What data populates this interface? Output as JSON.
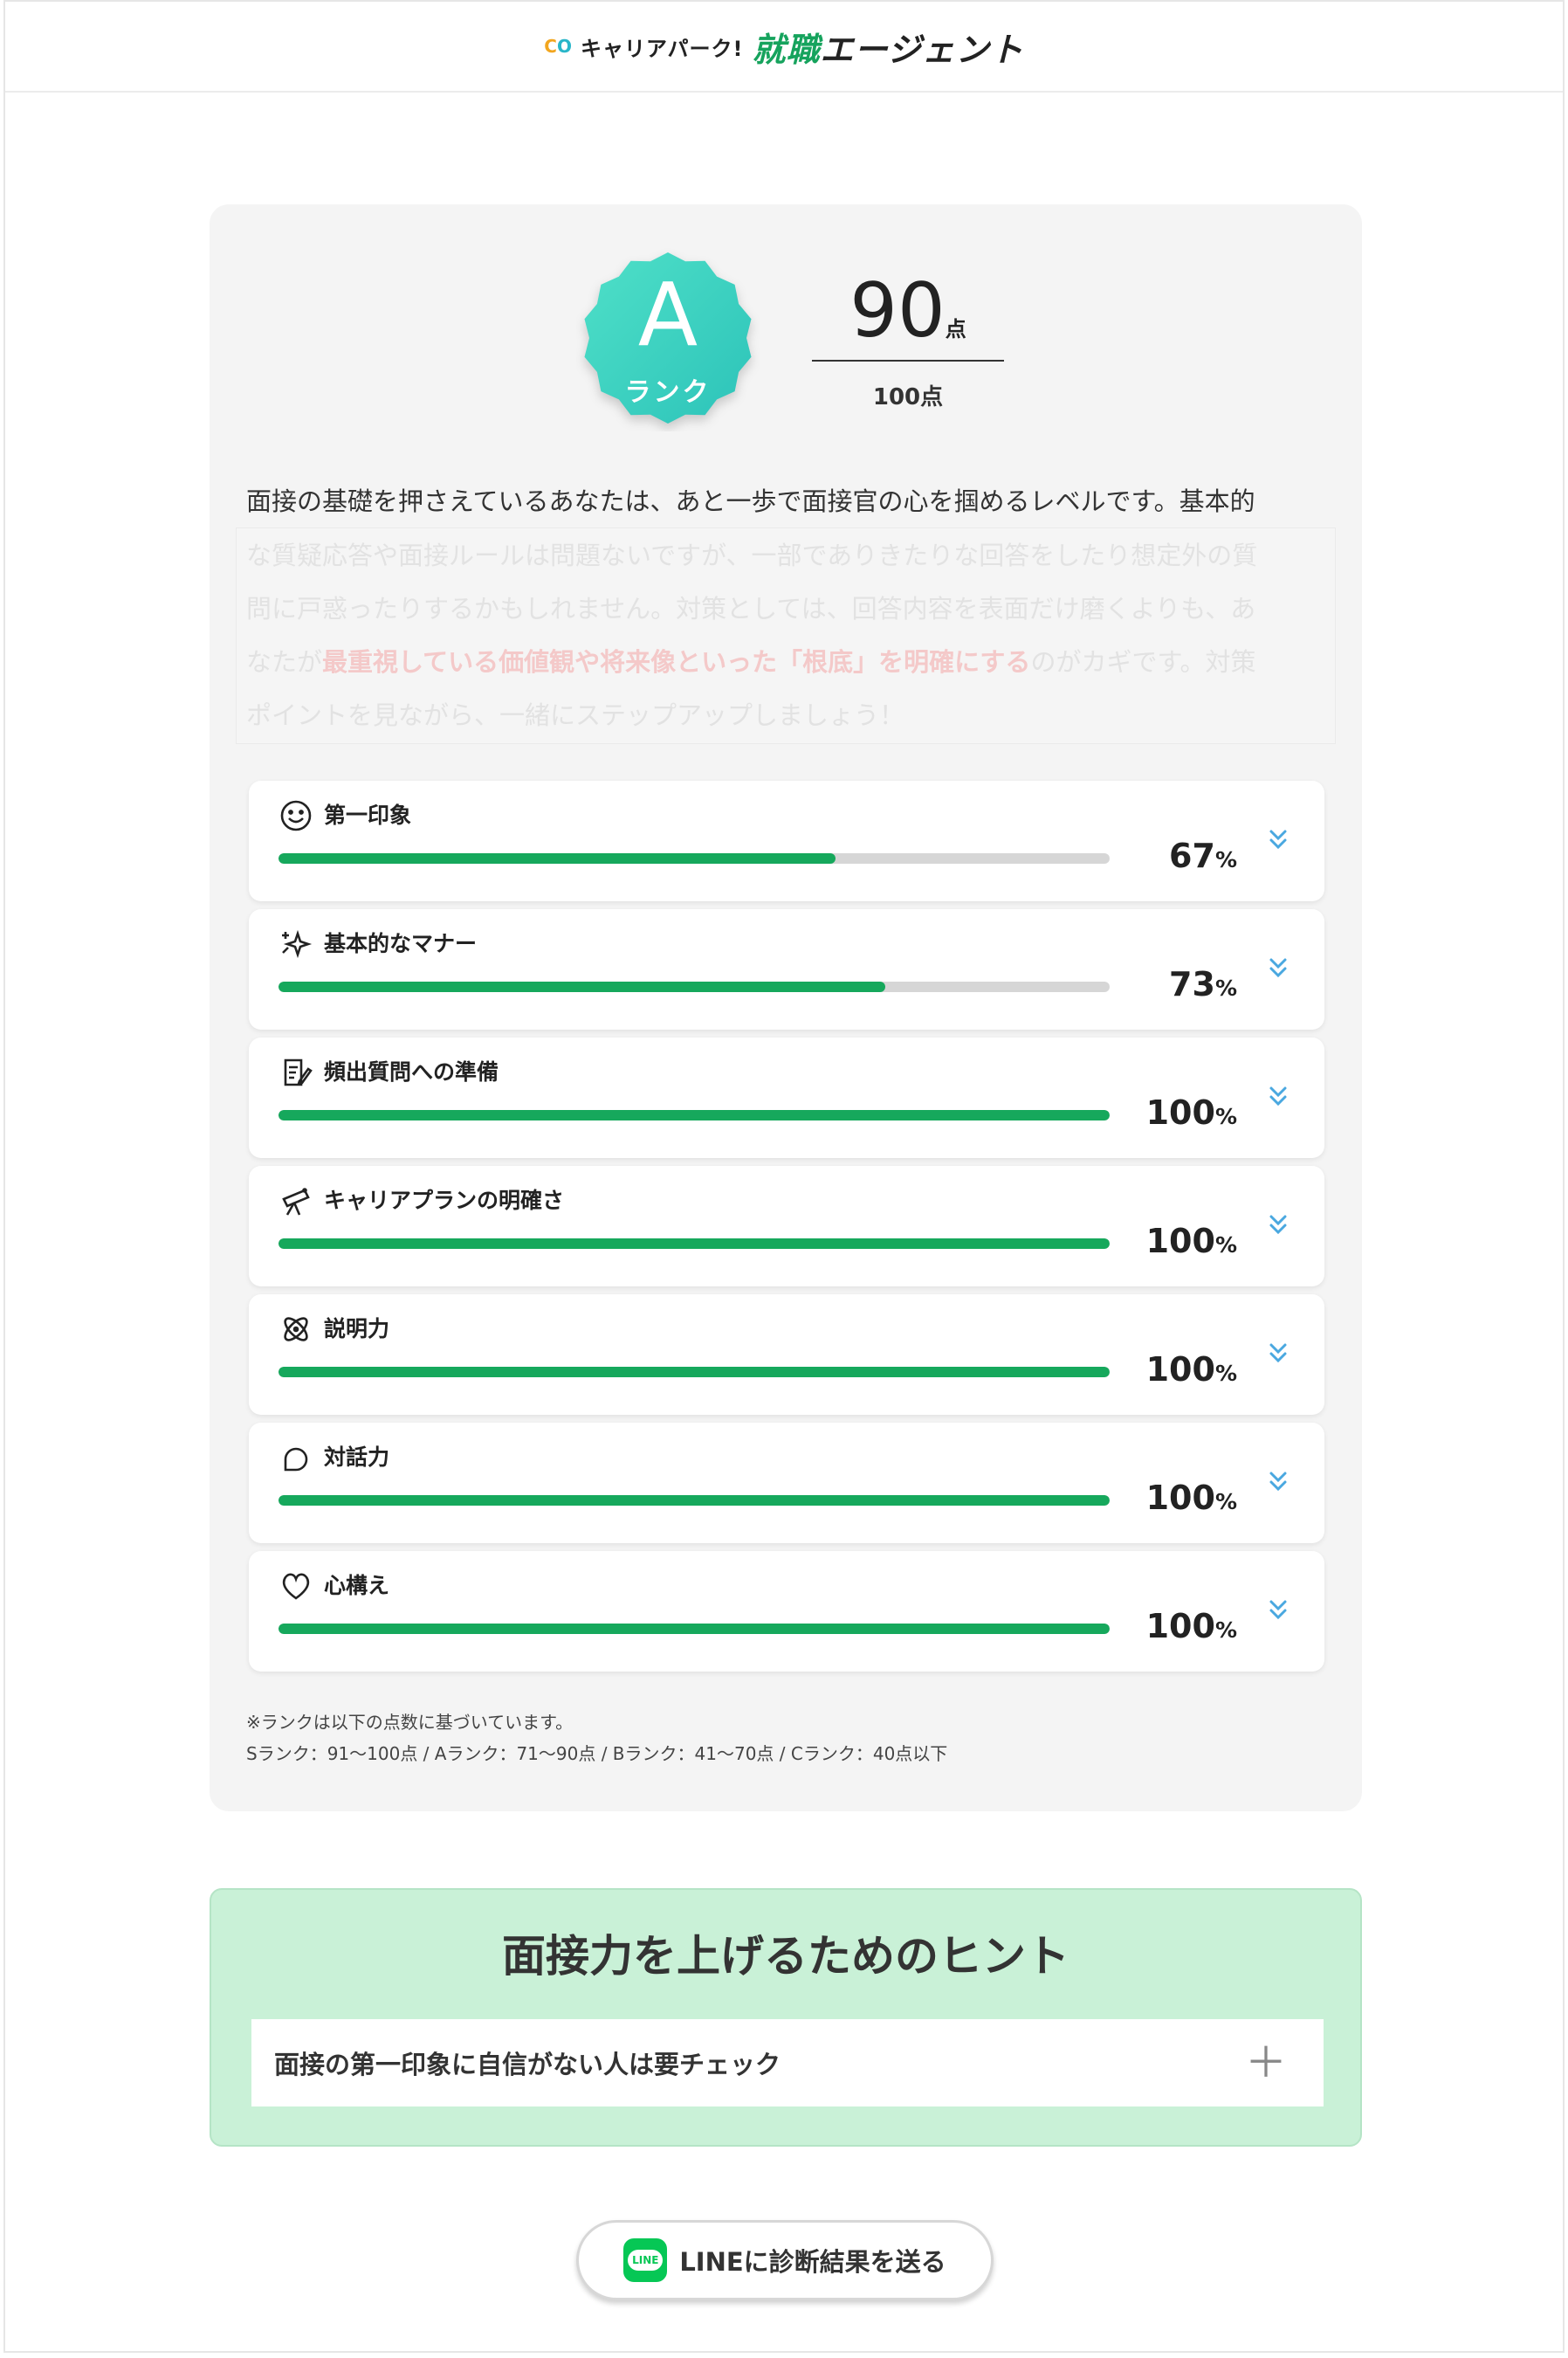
{
  "header": {
    "brand_prefix": "キャリアパーク!",
    "brand_main_green": "就職",
    "brand_main_dark": "エージェント"
  },
  "result": {
    "rank_letter": "A",
    "rank_label": "ランク",
    "score": "90",
    "score_unit": "点",
    "max_score": "100点",
    "description_first": "面接の基礎を押さえているあなたは、あと一歩で面接官の心を掴めるレベルです。基本的",
    "description_rest_1": "な質疑応答や面接ルールは問題ないですが、一部でありきたりな回答をしたり想定外の質",
    "description_rest_2": "問に戸惑ったりするかもしれません。対策としては、回答内容を表面だけ磨くよりも、あ",
    "description_rest_3a": "なたが",
    "description_rest_3_highlight": "最重視している価値観や将来像といった「根底」を明確にする",
    "description_rest_3b": "のがカギです。対策",
    "description_rest_4": "ポイントを見ながら、一緒にステップアップしましょう！"
  },
  "metrics": [
    {
      "label": "第一印象",
      "value": 67,
      "value_text": "67",
      "icon": "smile-icon"
    },
    {
      "label": "基本的なマナー",
      "value": 73,
      "value_text": "73",
      "icon": "sparkle-icon"
    },
    {
      "label": "頻出質問への準備",
      "value": 100,
      "value_text": "100",
      "icon": "note-edit-icon"
    },
    {
      "label": "キャリアプランの明確さ",
      "value": 100,
      "value_text": "100",
      "icon": "telescope-icon"
    },
    {
      "label": "説明力",
      "value": 100,
      "value_text": "100",
      "icon": "atom-icon"
    },
    {
      "label": "対話力",
      "value": 100,
      "value_text": "100",
      "icon": "speech-bubble-icon"
    },
    {
      "label": "心構え",
      "value": 100,
      "value_text": "100",
      "icon": "heart-icon"
    }
  ],
  "percent_unit": "%",
  "footnote": {
    "line1": "※ランクは以下の点数に基づいています。",
    "line2": "Sランク：91〜100点 / Aランク：71〜90点 / Bランク：41〜70点 / Cランク：40点以下"
  },
  "hints": {
    "title": "面接力を上げるためのヒント",
    "items": [
      "面接の第一印象に自信がない人は要チェック"
    ]
  },
  "line_button": {
    "icon_text": "LINE",
    "label": "LINEに診断結果を送る"
  },
  "colors": {
    "accent_green": "#16a85c",
    "badge_teal": "#3fd6c1",
    "hint_bg": "#c9f1d7",
    "line_green": "#06c755",
    "toggle_blue": "#4aa8e0"
  }
}
